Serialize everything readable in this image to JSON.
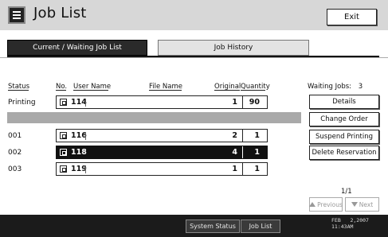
{
  "window": {
    "title": "Job List",
    "exit_label": "Exit"
  },
  "tabs": [
    {
      "label": "Current / Waiting Job List",
      "active": true
    },
    {
      "label": "Job History",
      "active": false
    }
  ],
  "columns": {
    "status": "Status",
    "no": "No.",
    "user_name": "User Name",
    "file_name": "File Name",
    "original": "Original",
    "quantity": "Quantity"
  },
  "jobs": [
    {
      "status": "Printing",
      "no": "114",
      "original": "1",
      "quantity": "90",
      "selected": false
    },
    {
      "status": "001",
      "no": "116",
      "original": "2",
      "quantity": "1",
      "selected": false
    },
    {
      "status": "002",
      "no": "118",
      "original": "4",
      "quantity": "1",
      "selected": true
    },
    {
      "status": "003",
      "no": "119",
      "original": "1",
      "quantity": "1",
      "selected": false
    }
  ],
  "side_panel": {
    "waiting_label": "Waiting Jobs:",
    "waiting_count": "3",
    "buttons": {
      "details": "Details",
      "change_order": "Change Order",
      "suspend_printing": "Suspend Printing",
      "delete_reservation": "Delete Reservation"
    },
    "page_indicator": "1/1",
    "previous_label": "Previous",
    "next_label": "Next"
  },
  "status_bar": {
    "system_status": "System Status",
    "job_list": "Job List",
    "date": "FEB   2,2007",
    "time": "11:43AM"
  },
  "icons": {
    "title": "job-list-icon",
    "document": "document-icon",
    "previous": "triangle-up-icon",
    "next": "triangle-down-icon"
  }
}
